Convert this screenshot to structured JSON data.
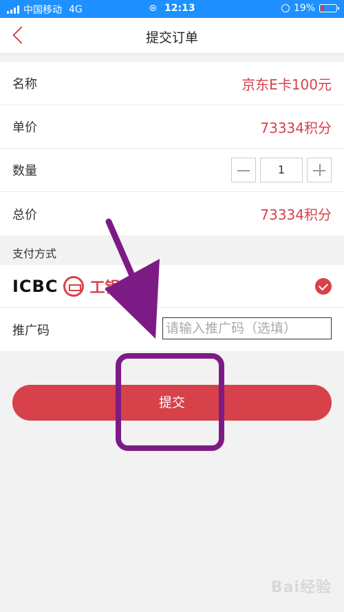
{
  "status_bar": {
    "carrier": "中国移动",
    "network": "4G",
    "time": "12:13",
    "battery": "19%",
    "battery_level": 0.19,
    "signal_bars": 4
  },
  "nav": {
    "title": "提交订单"
  },
  "order": {
    "name_label": "名称",
    "name_value": "京东E卡100元",
    "unit_price_label": "单价",
    "unit_price_value": "73334积分",
    "quantity_label": "数量",
    "quantity_value": "1",
    "total_label": "总价",
    "total_value": "73334积分"
  },
  "payment": {
    "section_title": "支付方式",
    "bank_logo_text": "ICBC",
    "bank_name_cn": "工银",
    "selected": true
  },
  "promo": {
    "label": "推广码",
    "placeholder": "请输入推广码（选填）"
  },
  "submit": {
    "label": "提交"
  },
  "annotations": {
    "color": "#7d1b86"
  },
  "watermark": "Bai经验"
}
